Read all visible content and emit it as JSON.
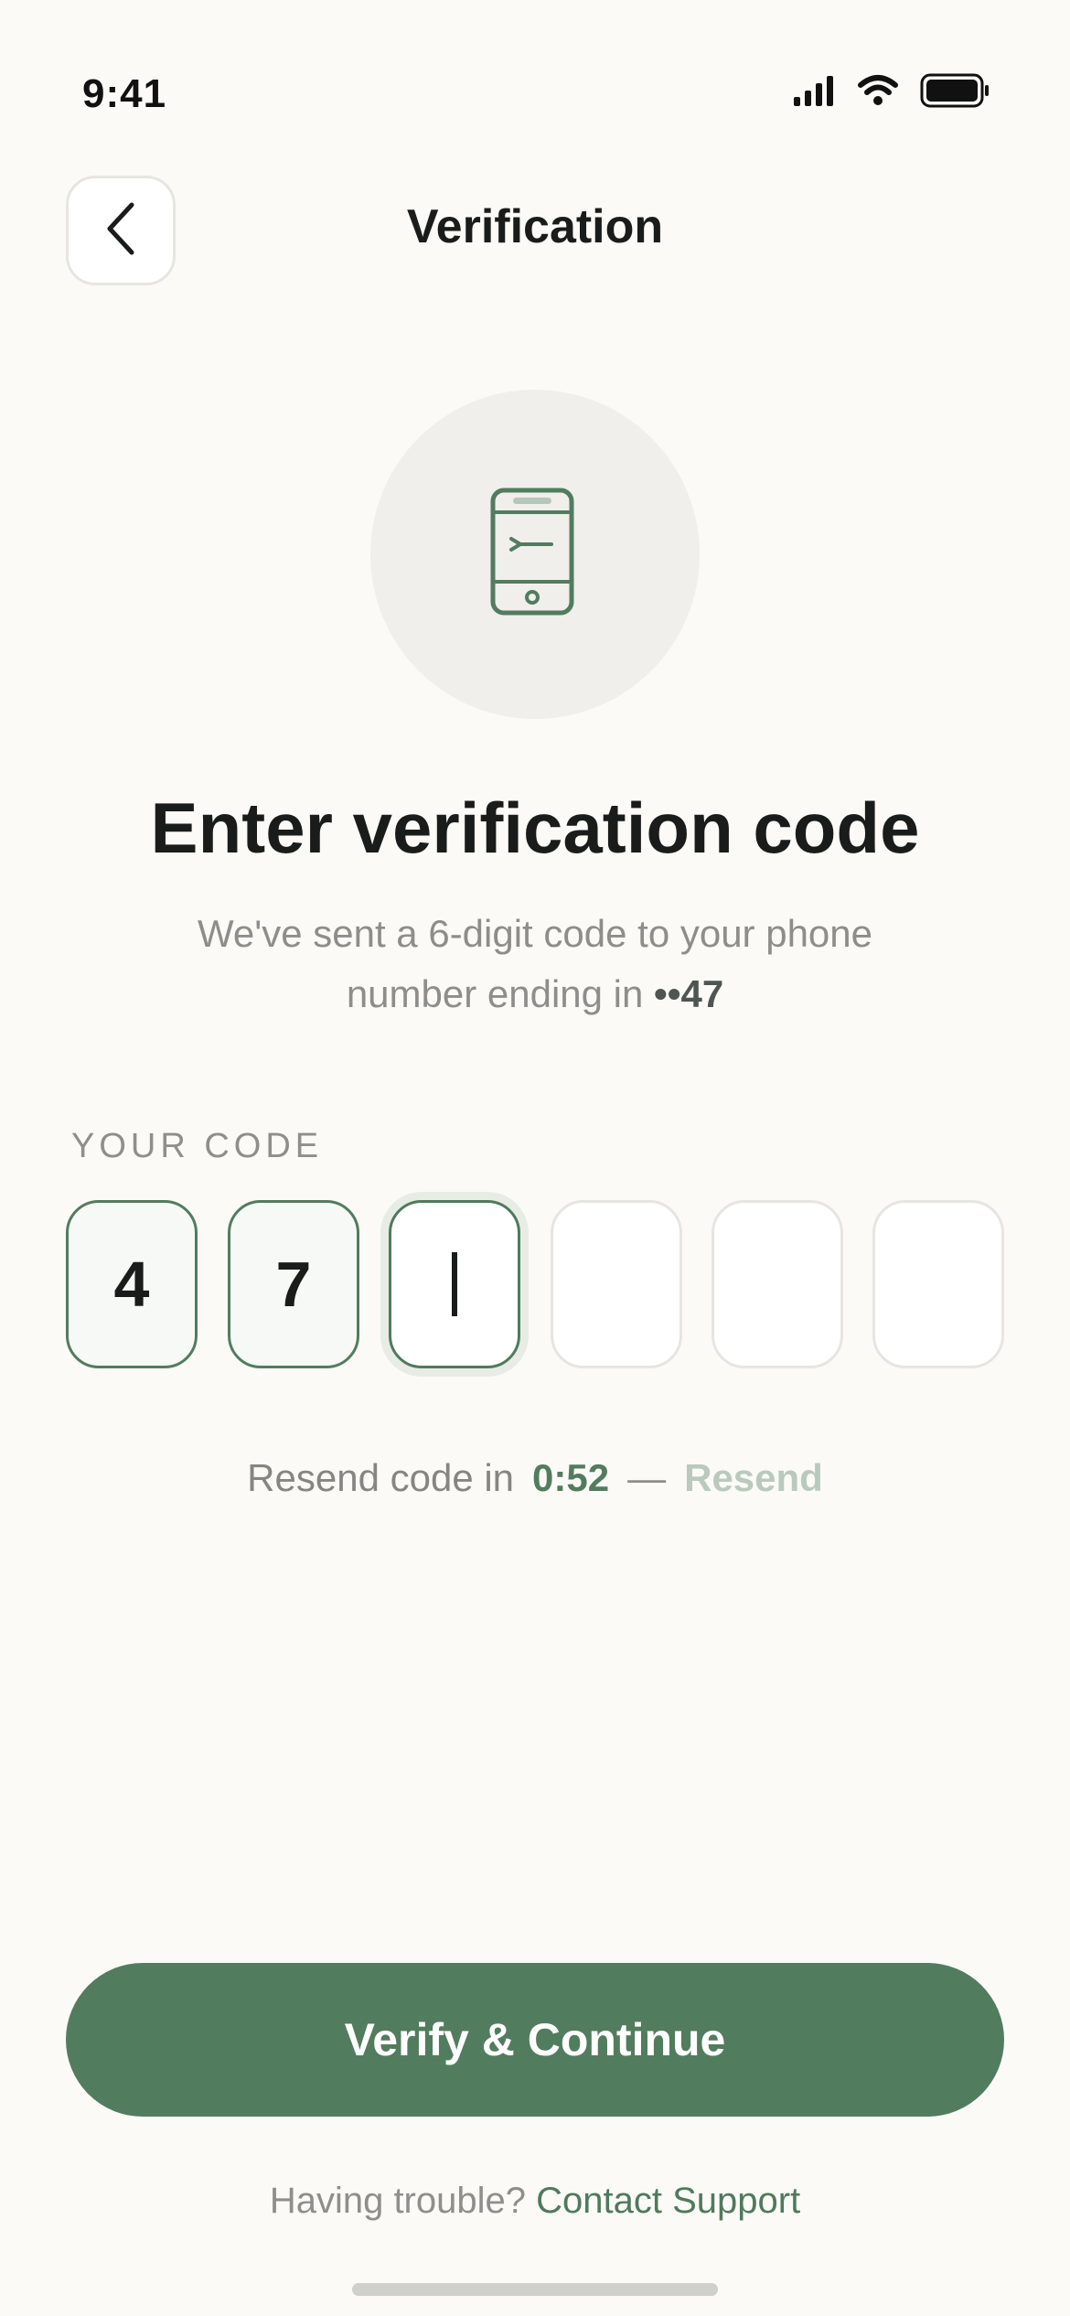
{
  "status_bar": {
    "time": "9:41"
  },
  "header": {
    "title": "Verification"
  },
  "hero": {
    "title": "Enter verification code",
    "subtitle_prefix": "We've sent a 6-digit code to your phone number ending in ",
    "masked_number": "••47"
  },
  "code": {
    "label": "YOUR CODE",
    "digits": [
      "4",
      "7",
      "",
      "",
      "",
      ""
    ],
    "active_index": 2
  },
  "resend": {
    "prefix": "Resend code in",
    "timer": "0:52",
    "separator": "—",
    "link": "Resend"
  },
  "cta": {
    "label": "Verify & Continue"
  },
  "help": {
    "prefix": "Having trouble?",
    "link": "Contact Support"
  },
  "colors": {
    "accent": "#527C5E",
    "background": "#FBFAF7",
    "muted_text": "#8D8D8A"
  },
  "icons": {
    "back": "chevron-left-icon",
    "hero": "phone-message-icon",
    "signal": "cellular-signal-icon",
    "wifi": "wifi-icon",
    "battery": "battery-icon"
  }
}
